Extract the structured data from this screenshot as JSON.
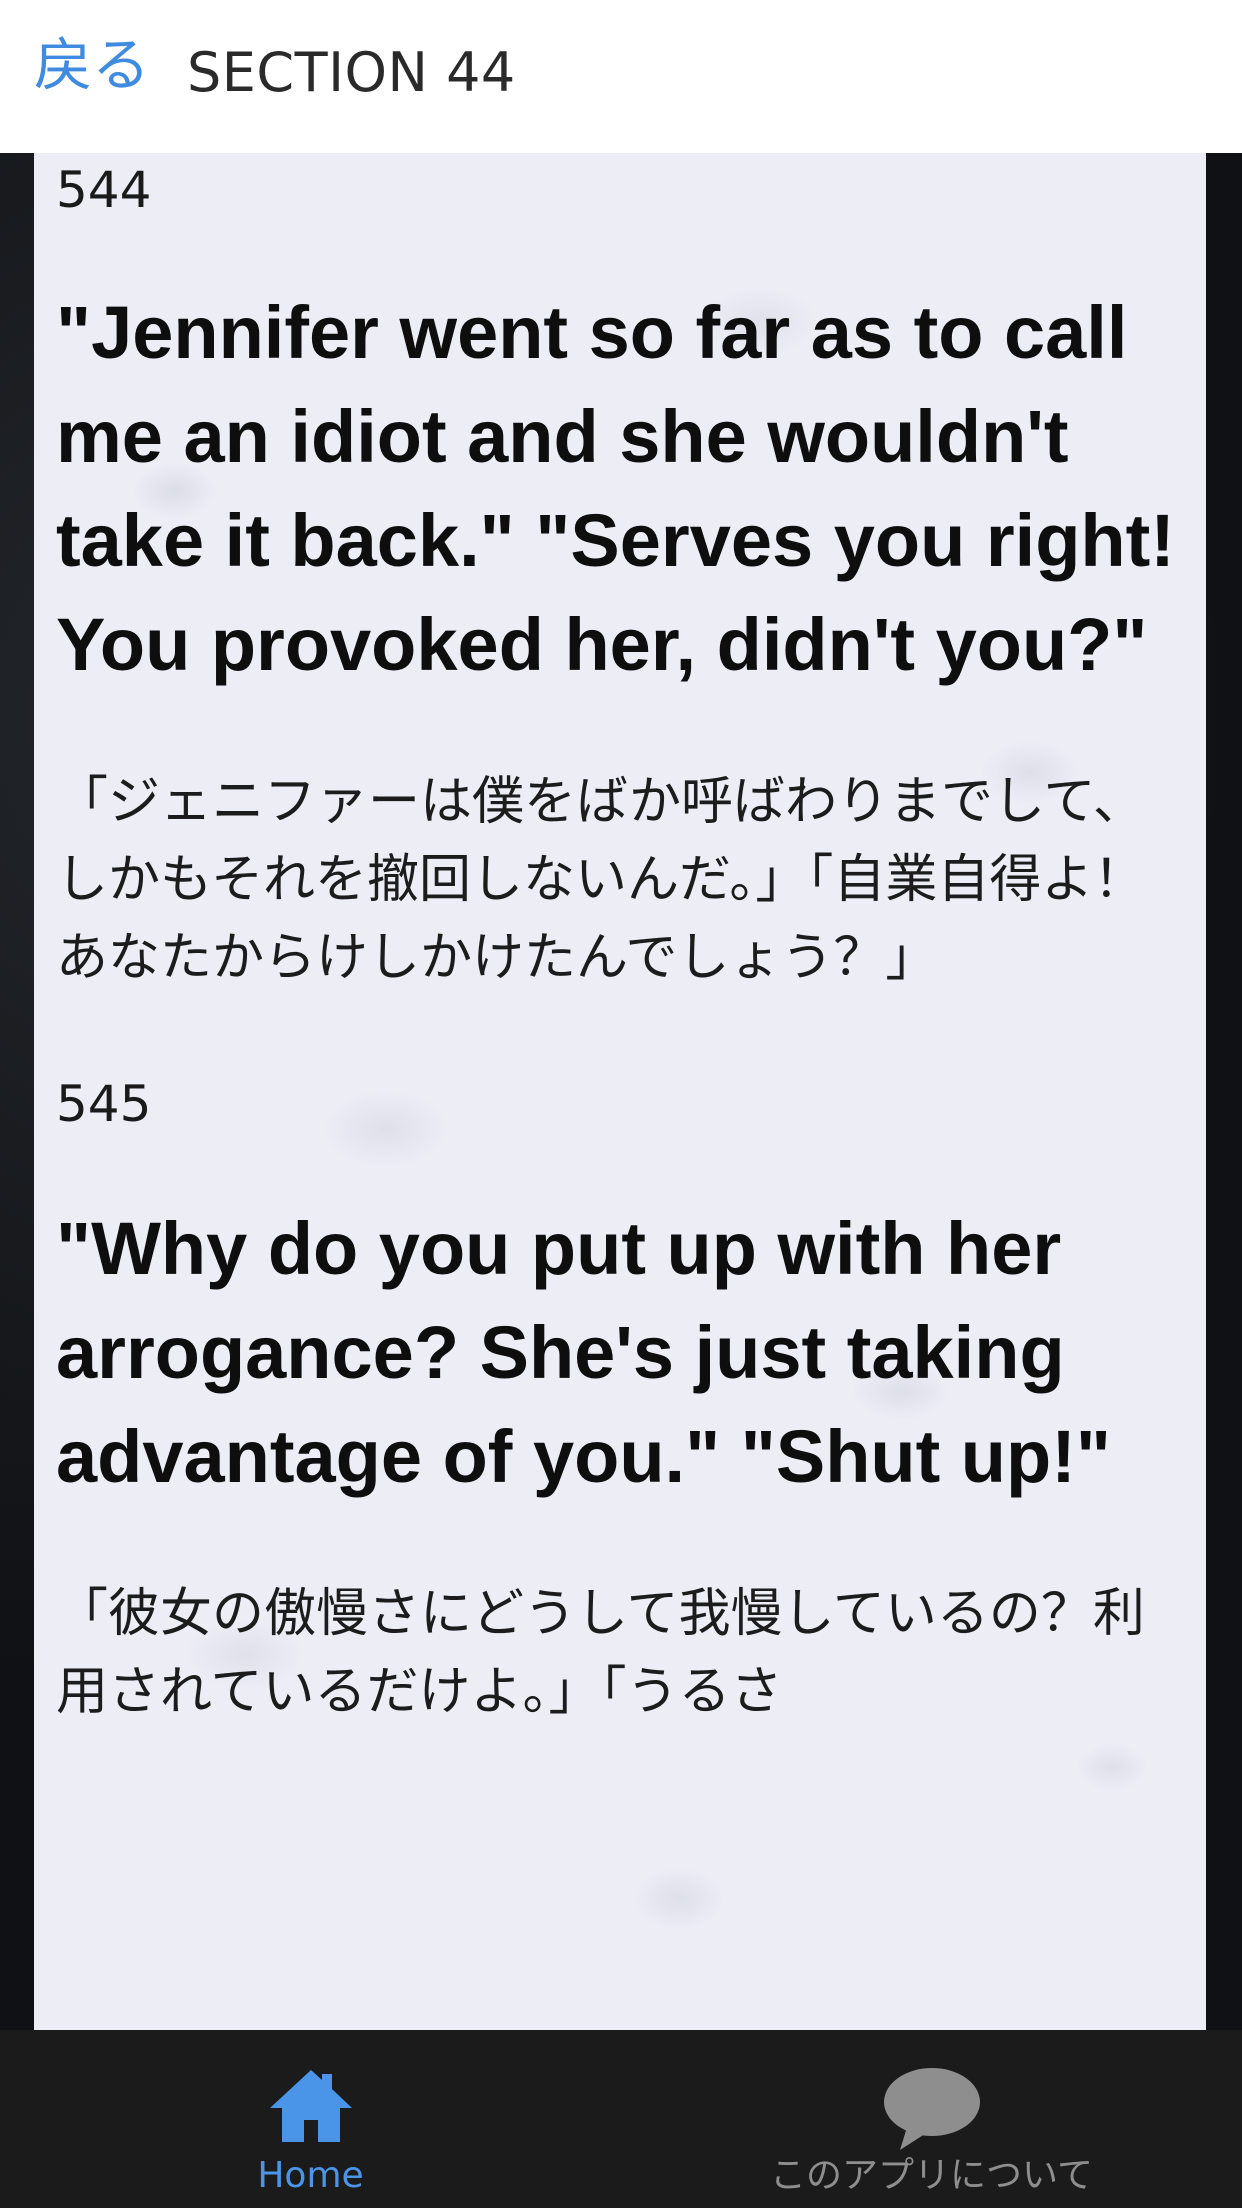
{
  "header": {
    "back_label": "戻る",
    "title": "SECTION 44"
  },
  "entries": [
    {
      "number": "544",
      "english": "\"Jennifer went so far as to call me an idiot and she wouldn't take it back.\" \"Serves you right! You provoked her, didn't you?\"",
      "japanese": "「ジェニファーは僕をばか呼ばわりまでして、しかもそれを撤回しないんだ。」「自業自得よ！あなたからけしかけたんでしょう？」"
    },
    {
      "number": "545",
      "english": "\"Why do you put up with her arrogance? She's just taking advantage of you.\" \"Shut up!\"",
      "japanese": "「彼女の傲慢さにどうして我慢しているの？利用されているだけよ。」「うるさ"
    }
  ],
  "bottom_nav": {
    "home": {
      "label": "Home",
      "icon": "home-icon",
      "color": "#4b95e8"
    },
    "about": {
      "label": "このアプリについて",
      "icon": "chat-bubble-icon",
      "color": "#8e8e8e"
    }
  },
  "colors": {
    "accent": "#3f8be0",
    "nav_background": "#1b1b1b",
    "paper": "#ecedf5"
  }
}
